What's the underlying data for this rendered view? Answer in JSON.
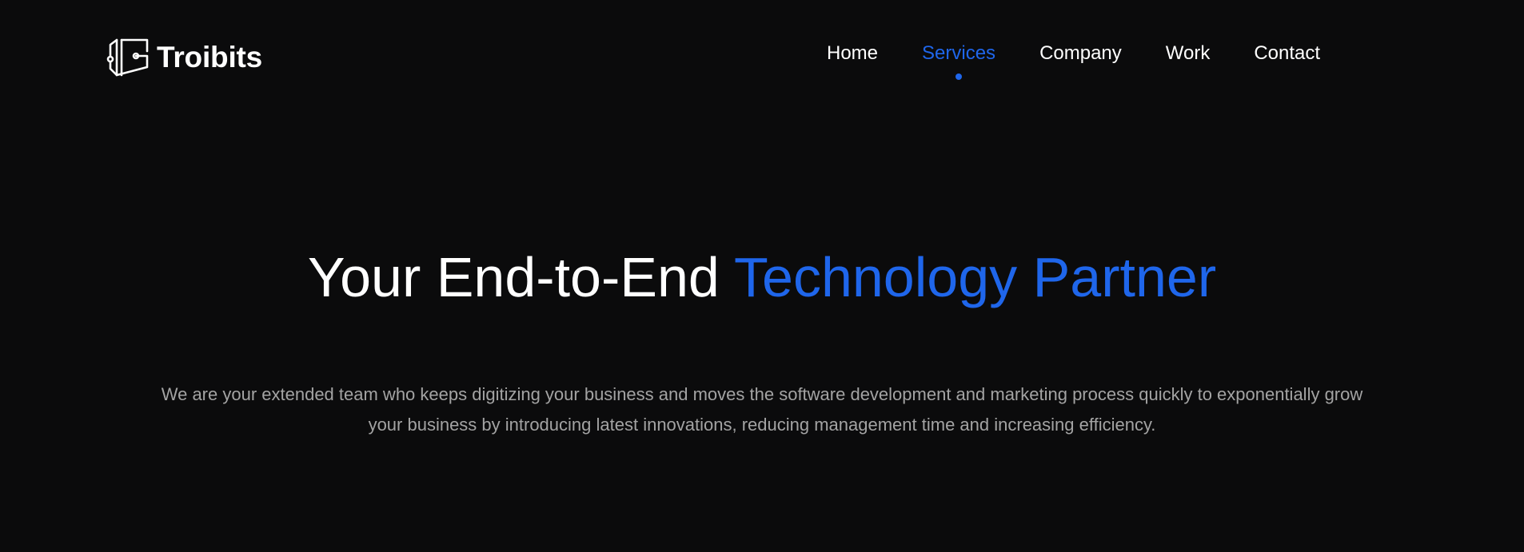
{
  "brand": {
    "name": "Troibits",
    "logo_icon": "troibits-logo-mark"
  },
  "nav": {
    "items": [
      {
        "label": "Home",
        "active": false
      },
      {
        "label": "Services",
        "active": true
      },
      {
        "label": "Company",
        "active": false
      },
      {
        "label": "Work",
        "active": false
      },
      {
        "label": "Contact",
        "active": false
      }
    ]
  },
  "hero": {
    "title_part1": "Your End-to-End",
    "title_part2": "Technology Partner",
    "description": "We are your extended team who keeps digitizing your business and moves the software development and marketing process quickly to exponentially grow your business by introducing latest innovations, reducing management time and increasing efficiency."
  },
  "colors": {
    "background": "#0b0b0c",
    "accent": "#1f66eb",
    "text_primary": "#ffffff",
    "text_secondary": "#a3a3a3"
  }
}
